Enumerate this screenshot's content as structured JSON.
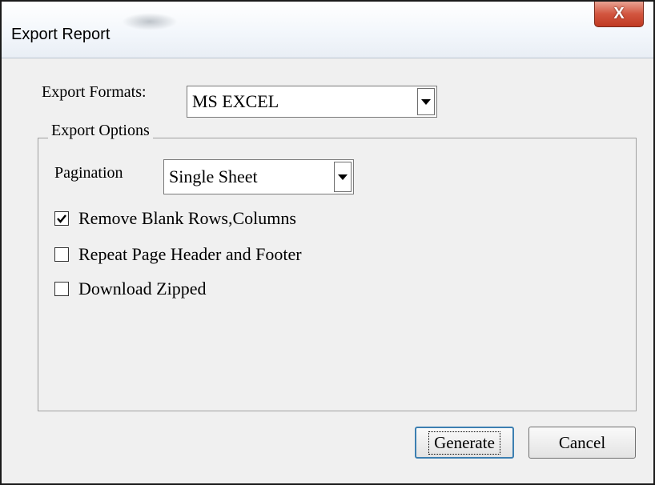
{
  "window": {
    "title": "Export Report",
    "close_label": "X"
  },
  "export_formats": {
    "label": "Export Formats:",
    "selected": "MS EXCEL"
  },
  "export_options": {
    "legend": "Export Options",
    "pagination": {
      "label": "Pagination",
      "selected": "Single Sheet"
    },
    "checkboxes": [
      {
        "label": "Remove Blank Rows,Columns",
        "checked": true
      },
      {
        "label": "Repeat Page Header and Footer",
        "checked": false
      },
      {
        "label": "Download Zipped",
        "checked": false
      }
    ]
  },
  "buttons": {
    "generate": "Generate",
    "cancel": "Cancel"
  },
  "icons": {
    "dropdown": "chevron-down-icon",
    "check": "check-icon",
    "close": "close-icon"
  }
}
